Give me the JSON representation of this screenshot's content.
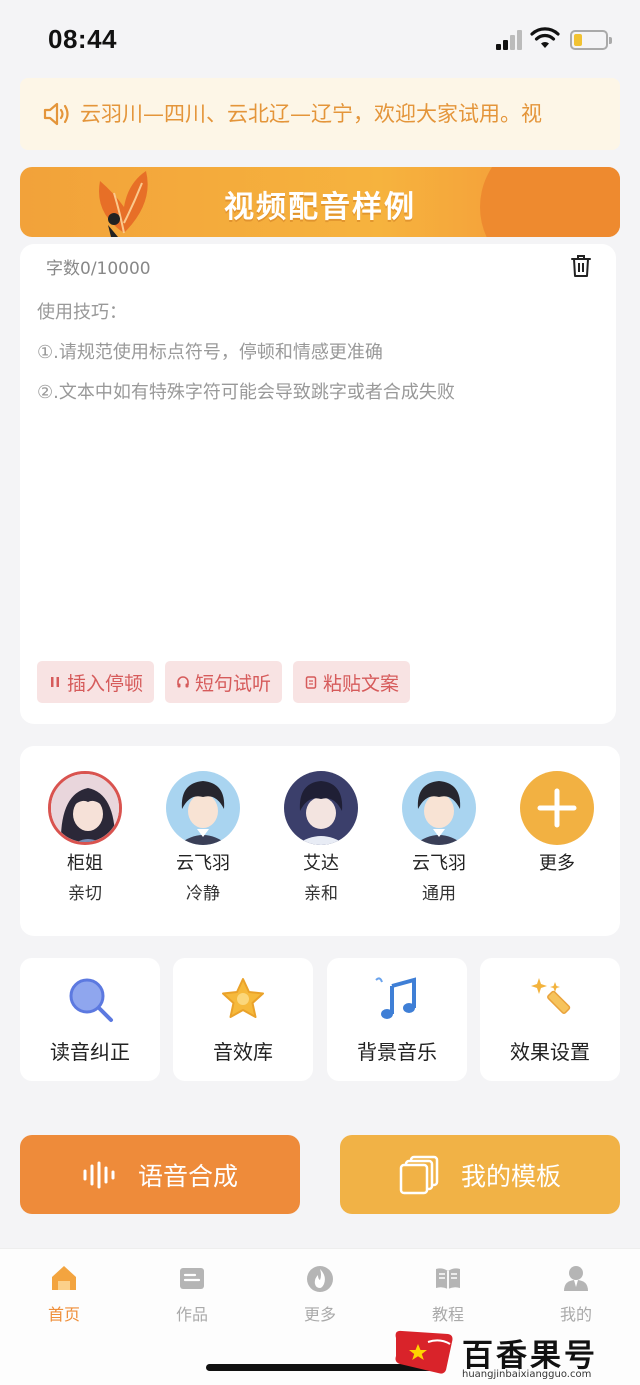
{
  "status_bar": {
    "time": "08:44"
  },
  "notice": {
    "text": "云羽川—四川、云北辽—辽宁，欢迎大家试用。视"
  },
  "banner": {
    "title": "视频配音样例"
  },
  "editor": {
    "count": "字数0/10000",
    "tips_title": "使用技巧：",
    "tip1": "①.请规范使用标点符号，停顿和情感更准确",
    "tip2": "②.文本中如有特殊字符可能会导致跳字或者合成失败",
    "chips": [
      "插入停顿",
      "短句试听",
      "粘贴文案"
    ]
  },
  "voices": [
    {
      "name": "柜姐",
      "desc": "亲切",
      "icon": "avatar-girl"
    },
    {
      "name": "云飞羽",
      "desc": "冷静",
      "icon": "avatar-boy"
    },
    {
      "name": "艾达",
      "desc": "亲和",
      "icon": "avatar-child"
    },
    {
      "name": "云飞羽",
      "desc": "通用",
      "icon": "avatar-boy"
    },
    {
      "name": "更多",
      "desc": "",
      "icon": "plus-icon"
    }
  ],
  "tools": [
    {
      "label": "读音纠正",
      "icon": "magnifier-icon"
    },
    {
      "label": "音效库",
      "icon": "star-icon"
    },
    {
      "label": "背景音乐",
      "icon": "music-note-icon"
    },
    {
      "label": "效果设置",
      "icon": "magic-wand-icon"
    }
  ],
  "actions": {
    "synthesize": "语音合成",
    "templates": "我的模板"
  },
  "tabs": [
    {
      "label": "首页",
      "icon": "home-icon",
      "active": true
    },
    {
      "label": "作品",
      "icon": "folder-icon",
      "active": false
    },
    {
      "label": "更多",
      "icon": "fire-icon",
      "active": false
    },
    {
      "label": "教程",
      "icon": "book-icon",
      "active": false
    },
    {
      "label": "我的",
      "icon": "user-icon",
      "active": false
    }
  ],
  "watermark": {
    "title": "百香果号",
    "url": "huangjinbaixiangguo.com"
  },
  "colors": {
    "accent": "#ef8f3a",
    "accent_light": "#f1b246",
    "chip_text": "#d65b5b",
    "notice_text": "#e4953a"
  }
}
